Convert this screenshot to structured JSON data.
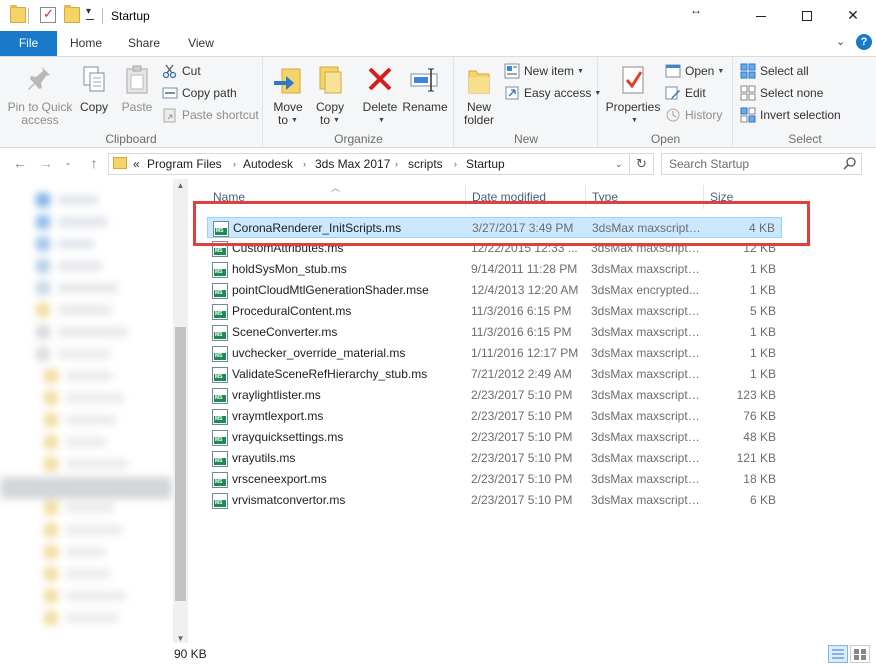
{
  "window": {
    "title": "Startup",
    "minimize_glyph": "",
    "maximize_glyph": "",
    "close_glyph": "✕",
    "resize_glyph": "↔"
  },
  "tabs": {
    "file": "File",
    "home": "Home",
    "share": "Share",
    "view": "View"
  },
  "ribbon": {
    "clipboard": {
      "label": "Clipboard",
      "pin": "Pin to Quick access",
      "pin_l1": "Pin to Quick",
      "pin_l2": "access",
      "copy": "Copy",
      "paste": "Paste",
      "cut": "Cut",
      "copy_path": "Copy path",
      "paste_shortcut": "Paste shortcut"
    },
    "organize": {
      "label": "Organize",
      "move_to_l1": "Move",
      "move_to_l2": "to",
      "copy_to_l1": "Copy",
      "copy_to_l2": "to",
      "delete": "Delete",
      "rename": "Rename"
    },
    "new": {
      "label": "New",
      "new_folder_l1": "New",
      "new_folder_l2": "folder",
      "new_item": "New item",
      "easy_access": "Easy access"
    },
    "open": {
      "label": "Open",
      "properties": "Properties",
      "open": "Open",
      "edit": "Edit",
      "history": "History"
    },
    "select": {
      "label": "Select",
      "select_all": "Select all",
      "select_none": "Select none",
      "invert": "Invert selection"
    }
  },
  "address": {
    "overflow": "«",
    "crumbs": [
      "Program Files",
      "Autodesk",
      "3ds Max 2017",
      "scripts",
      "Startup"
    ],
    "search_placeholder": "Search Startup"
  },
  "columns": {
    "name": "Name",
    "date": "Date modified",
    "type": "Type",
    "size": "Size"
  },
  "files": [
    {
      "name": "CoronaRenderer_InitScripts.ms",
      "date": "3/27/2017 3:49 PM",
      "type": "3dsMax maxscript ...",
      "size": "4 KB",
      "selected": true
    },
    {
      "name": "CustomAttributes.ms",
      "date": "12/22/2015 12:33 ...",
      "type": "3dsMax maxscript ...",
      "size": "12 KB"
    },
    {
      "name": "holdSysMon_stub.ms",
      "date": "9/14/2011 11:28 PM",
      "type": "3dsMax maxscript ...",
      "size": "1 KB"
    },
    {
      "name": "pointCloudMtlGenerationShader.mse",
      "date": "12/4/2013 12:20 AM",
      "type": "3dsMax encrypted...",
      "size": "1 KB"
    },
    {
      "name": "ProceduralContent.ms",
      "date": "11/3/2016 6:15 PM",
      "type": "3dsMax maxscript ...",
      "size": "5 KB"
    },
    {
      "name": "SceneConverter.ms",
      "date": "11/3/2016 6:15 PM",
      "type": "3dsMax maxscript ...",
      "size": "1 KB"
    },
    {
      "name": "uvchecker_override_material.ms",
      "date": "1/11/2016 12:17 PM",
      "type": "3dsMax maxscript ...",
      "size": "1 KB"
    },
    {
      "name": "ValidateSceneRefHierarchy_stub.ms",
      "date": "7/21/2012 2:49 AM",
      "type": "3dsMax maxscript ...",
      "size": "1 KB"
    },
    {
      "name": "vraylightlister.ms",
      "date": "2/23/2017 5:10 PM",
      "type": "3dsMax maxscript ...",
      "size": "123 KB"
    },
    {
      "name": "vraymtlexport.ms",
      "date": "2/23/2017 5:10 PM",
      "type": "3dsMax maxscript ...",
      "size": "76 KB"
    },
    {
      "name": "vrayquicksettings.ms",
      "date": "2/23/2017 5:10 PM",
      "type": "3dsMax maxscript ...",
      "size": "48 KB"
    },
    {
      "name": "vrayutils.ms",
      "date": "2/23/2017 5:10 PM",
      "type": "3dsMax maxscript ...",
      "size": "121 KB"
    },
    {
      "name": "vrsceneexport.ms",
      "date": "2/23/2017 5:10 PM",
      "type": "3dsMax maxscript ...",
      "size": "18 KB"
    },
    {
      "name": "vrvismatconvertor.ms",
      "date": "2/23/2017 5:10 PM",
      "type": "3dsMax maxscript ...",
      "size": "6 KB"
    }
  ],
  "status": {
    "text": "90 KB"
  },
  "colors": {
    "accent": "#1979ca",
    "selection": "#cce8ff",
    "highlight_box": "#e0403b"
  }
}
